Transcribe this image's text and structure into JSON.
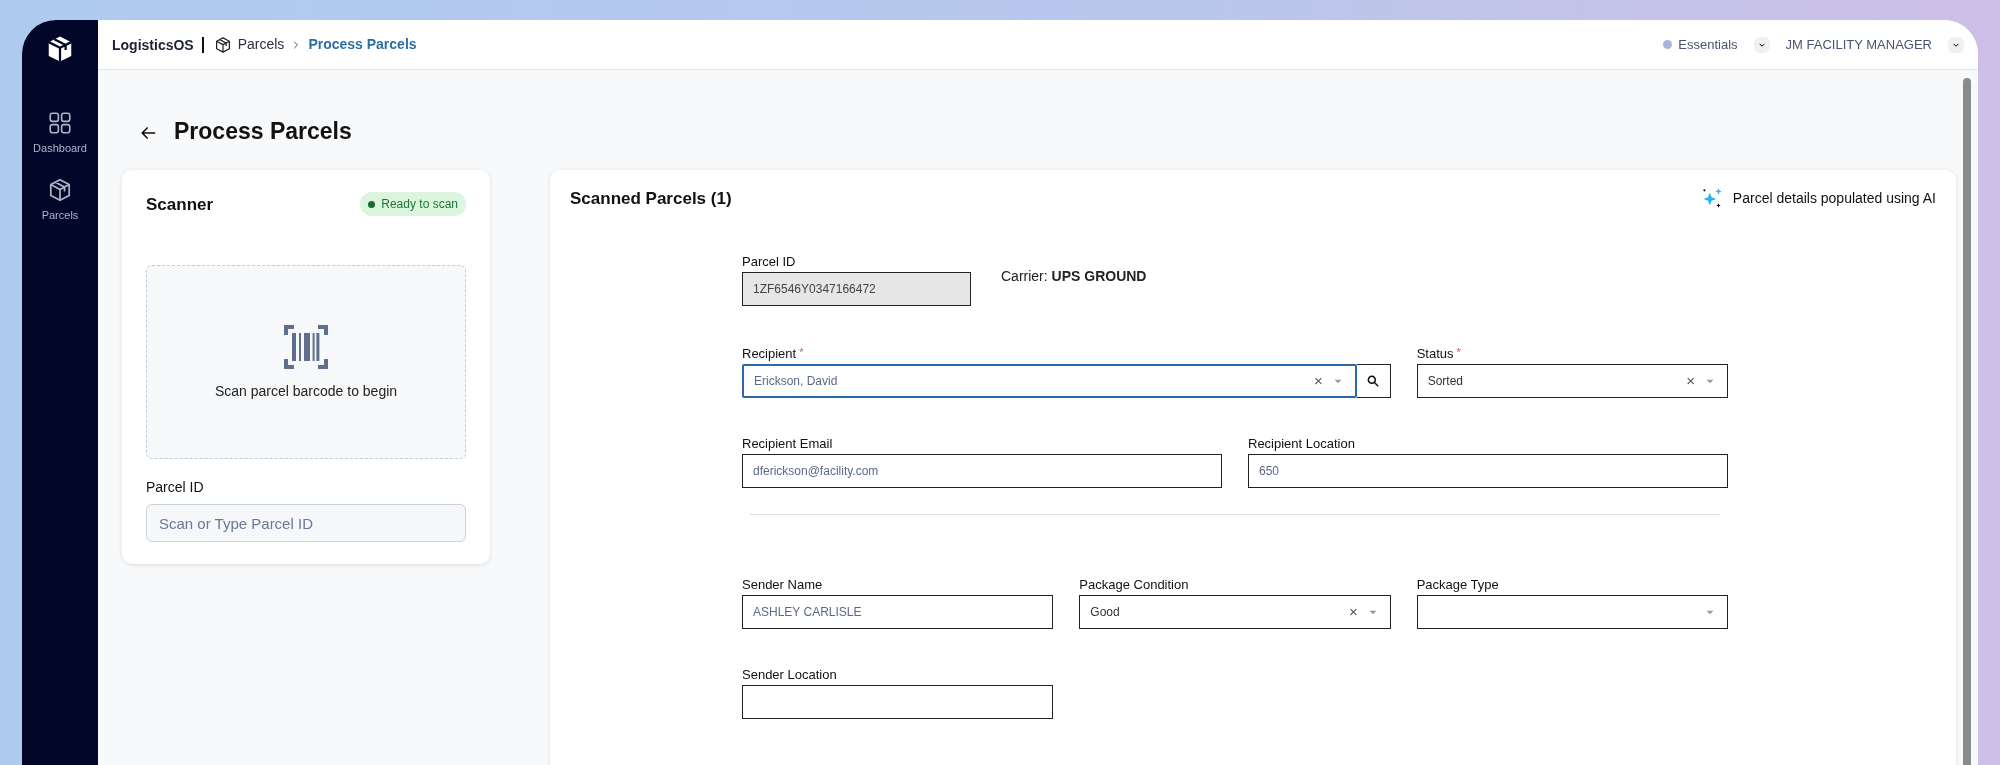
{
  "app": {
    "name": "LogisticsOS"
  },
  "sidebar": {
    "items": [
      {
        "label": "Dashboard",
        "kind": "dashboard"
      },
      {
        "label": "Parcels",
        "kind": "parcels"
      }
    ]
  },
  "breadcrumb": [
    {
      "label": "Parcels",
      "current": false
    },
    {
      "label": "Process Parcels",
      "current": true
    }
  ],
  "header": {
    "plan": "Essentials",
    "user": "JM FACILITY MANAGER"
  },
  "page": {
    "title": "Process Parcels"
  },
  "scanner": {
    "title": "Scanner",
    "status": "Ready to scan",
    "prompt": "Scan parcel barcode to begin",
    "field_label": "Parcel ID",
    "placeholder": "Scan or Type Parcel ID"
  },
  "scanned": {
    "title": "Scanned Parcels (1)",
    "ai_note": "Parcel details populated using AI",
    "parcel_id": {
      "label": "Parcel ID",
      "value": "1ZF6546Y0347166472",
      "disabled": true
    },
    "carrier": {
      "label": "Carrier:",
      "value": "UPS GROUND"
    },
    "sections": [
      {
        "rows": [
          {
            "fields": [
              {
                "label": "Recipient",
                "required_mark": "*",
                "kind": "select",
                "focused": true,
                "search": true,
                "value": "Erickson, David",
                "clear_icon": "×"
              },
              {
                "label": "Status",
                "required_mark": "*",
                "kind": "select",
                "focused": false,
                "value": "Sorted",
                "clear_icon": "×"
              }
            ]
          },
          {
            "fields": [
              {
                "label": "Recipient Email",
                "kind": "text",
                "focused": false,
                "value": "dferickson@facility.com"
              },
              {
                "label": "Recipient Location",
                "kind": "text",
                "focused": false,
                "value": "650"
              }
            ]
          }
        ]
      },
      {
        "rows": [
          {
            "fields": [
              {
                "label": "Sender Name",
                "kind": "text",
                "focused": false,
                "value": "ASHLEY CARLISLE"
              },
              {
                "label": "Package Condition",
                "kind": "select",
                "focused": false,
                "value": "Good",
                "clear_icon": "×"
              },
              {
                "label": "Package Type",
                "kind": "select",
                "focused": false
              }
            ]
          },
          {
            "fields": [
              {
                "label": "Sender Location",
                "kind": "text",
                "focused": false
              }
            ]
          }
        ]
      }
    ]
  }
}
